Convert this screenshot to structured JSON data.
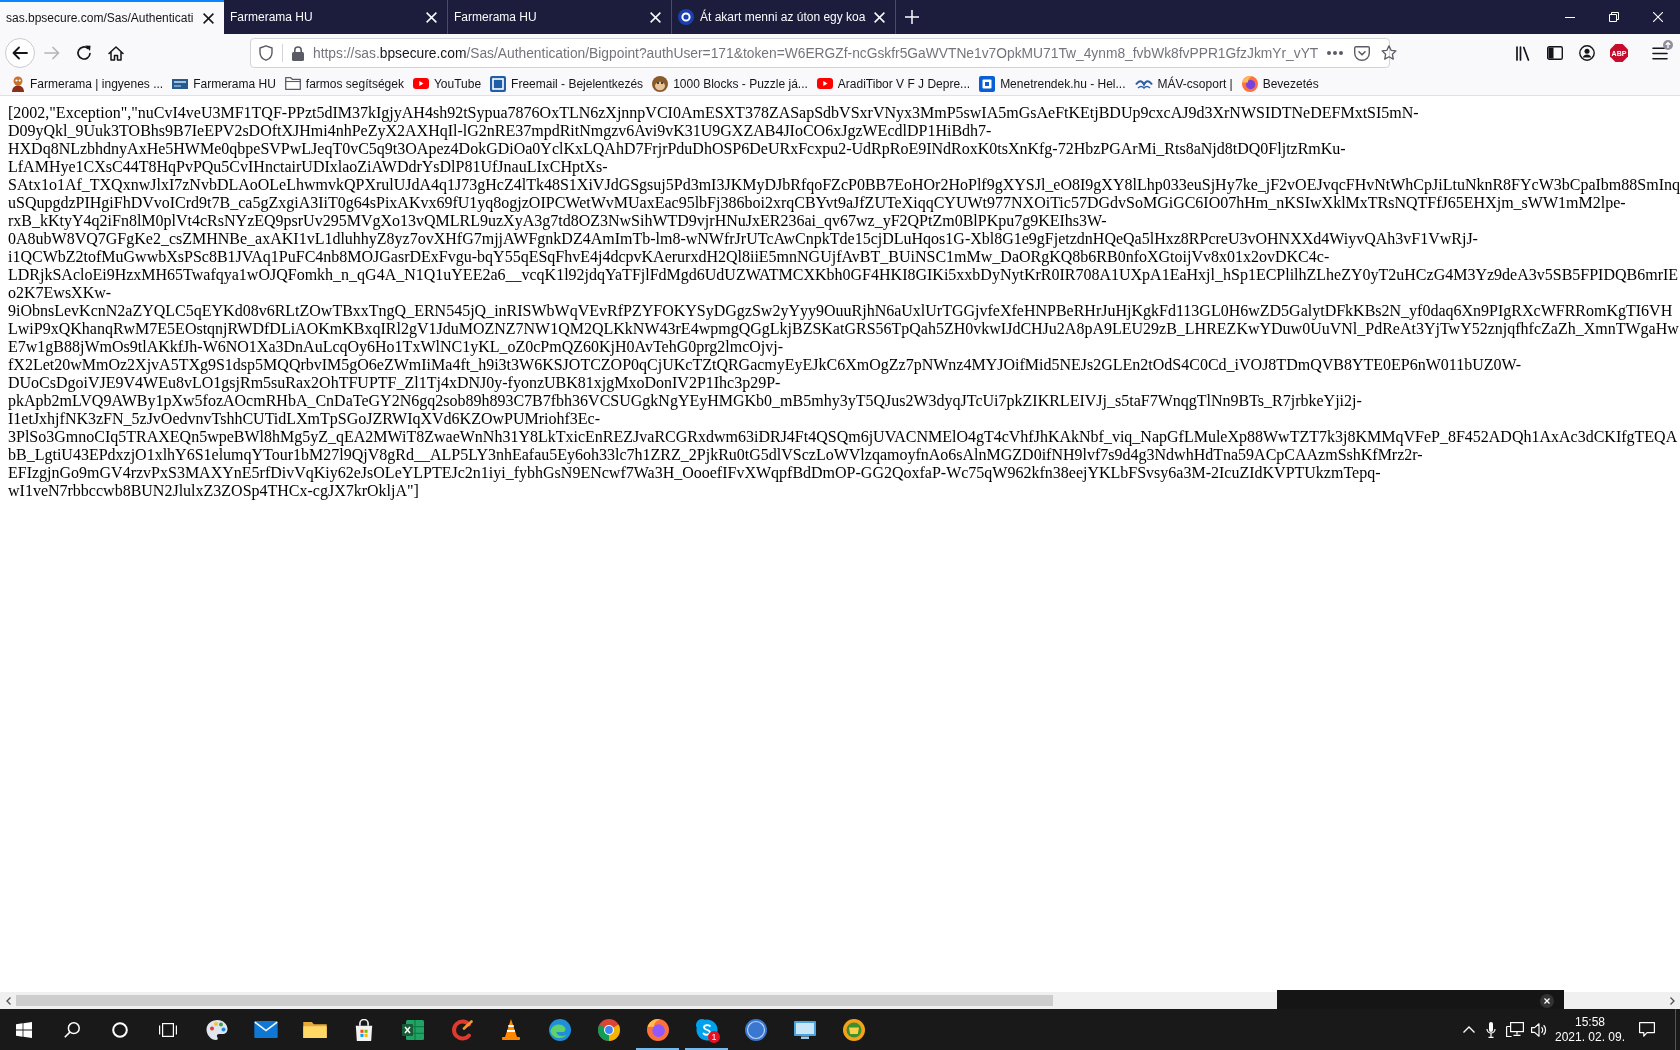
{
  "tabs": [
    {
      "title": "sas.bpsecure.com/Sas/Authenticati",
      "selected": true,
      "favicon": false
    },
    {
      "title": "Farmerama HU",
      "selected": false,
      "favicon": false
    },
    {
      "title": "Farmerama HU",
      "selected": false,
      "favicon": false
    },
    {
      "title": "Át akart menni az úton egy koa",
      "selected": false,
      "favicon": true
    }
  ],
  "toolbar": {
    "nav_buttons": [
      {
        "disabled": false
      },
      {
        "disabled": true
      },
      {
        "disabled": false
      },
      {
        "disabled": false
      }
    ],
    "url": {
      "scheme_host": "https://sas.",
      "domain": "bpsecure.com",
      "path": "/Sas/Authentication/Bigpoint?authUser=171&token=W6ERGZf-ncGskfr5GaWVTNe1v7OpkMU71Tw_4ynm8_fvbWk8fvPPR1GfzJkmYr_vYT"
    },
    "extension_label": "ABP"
  },
  "bookmarks": [
    {
      "label": "Farmerama | ingyenes ..."
    },
    {
      "label": "Farmerama HU"
    },
    {
      "label": "farmos segítségek"
    },
    {
      "label": "YouTube"
    },
    {
      "label": "Freemail - Bejelentkezés"
    },
    {
      "label": "1000 Blocks - Puzzle já..."
    },
    {
      "label": "AradiTibor V F J Depre..."
    },
    {
      "label": "Menetrendek.hu - Hel..."
    },
    {
      "label": "MÁV-csoport |"
    },
    {
      "label": "Bevezetés"
    }
  ],
  "page": {
    "lines": [
      "[2002,\"Exception\",\"nuCvI4veU3MF1TQF-PPzt5dIM37kIgjyAH4sh92tSypua7876OxTLN6zXjnnpVCI0AmESXT378ZASapSdbVSxrVNyx3MmP5swIA5mGsAeFtKEtjBDUp9cxcAJ9d3XrNWSIDTNeDEFMxtSI5mN-",
      "D09yQkl_9Uuk3TOBhs9B7IeEPV2sDOftXJHmi4nhPeZyX2AXHqIl-lG2nRE37mpdRitNmgzv6Avi9vK31U9GXZAB4JIoCO6xJgzWEcdlDP1HiBdh7-",
      "HXDq8NLzbhdnyAxHe5HWMe0qbpeSVPwLJeqT0vC5q9t3OApez4DokGDiOa0YclKxLQAhD7FrjrPduDhOSP6DeURxFcxpu2-UdRpRoE9INdRoxK0tsXnKfg-72HbzPGArMi_Rts8aNjd8tDQ0FljtzRmKu-",
      "LfAMHye1CXsC44T8HqPvPQu5CvIHnctairUDIxlaoZiAWDdrYsDlP81UfJnauLIxCHptXs-",
      "SAtx1o1Af_TXQxnwJlxI7zNvbDLAoOLeLhwmvkQPXrulUJdA4q1J73gHcZ4lTk48S1XiVJdGSgsuj5Pd3mI3JKMyDJbRfqoFZcP0BB7EoHOr2HoPlf9gXYSJl_eO8I9gXY8lLhp033euSjHy7ke_jF2vOEJvqcFHvNtWhCpJiLtuNknR8FYcW3bCpaIbm88SmInq",
      "uSQupgdzPIHgiFhDVvoICrd9t7B_ca5gZxgiA3IiT0g64sPixAKvx69fU1yq8ogjzOIPCWetWvMUaxEac95lbFj386boi2xrqCBYvt9aJfZUTeXiqqCYUWt977NXOiTic57DGdvSoMGiGC6IO07hHm_nKSIwXklMxTRsNQTFfJ65EHXjm_sWW1mM2lpe-",
      "rxB_kKtyY4q2iFn8lM0plVt4cRsNYzEQ9psrUv295MVgXo13vQMLRL9uzXyA3g7td8OZ3NwSihWTD9vjrHNuJxER236ai_qv67wz_yF2QPtZm0BlPKpu7g9KEIhs3W-",
      "0A8ubW8VQ7GFgKe2_csZMHNBe_axAKI1vL1dluhhyZ8yz7ovXHfG7mjjAWFgnkDZ4AmImTb-lm8-wNWfrJrUTcAwCnpkTde15cjDLuHqos1G-Xbl8G1e9gFjetzdnHQeQa5lHxz8RPcreU3vOHNXXd4WiyvQAh3vF1VwRjJ-",
      "i1QCWbZ2tofMuGwwbXsPSc8B1JVAq1PuFC4nb8MOJGasrDExFvgu-bqY55qESqFhvE4j4dcpvKAerurxdH2Ql8iiE5mnNGUjfAvBT_BUiNSC1mMw_DaORgKQ8b6RB0nfoXGtoijVv8x01x2ovDKC4c-",
      "LDRjkSAcloEi9HzxMH65Twafqya1wOJQFomkh_n_qG4A_N1Q1uYEE2a6__vcqK1l92jdqYaTFjlFdMgd6UdUZWATMCXKbh0GF4HKI8GIKi5xxbDyNytKrR0IR708A1UXpA1EaHxjl_hSp1ECPlilhZLheZY0yT2uHCzG4M3Yz9deA3v5SB5FPIDQB6mrIE",
      "o2K7EwsXKw-",
      "9iObnsLevKcnN2aZYQLC5qEYKd08v6RLtZOwTBxxTngQ_ERN545jQ_inRISWbWqVEvRfPZYFOKYSyDGgzSw2yYyy9OuuRjhN6aUxlUrTGGjvfeXfeHNPBeRHrJuHjKgkFd113GL0H6wZD5GalytDFkKBs2N_yf0daq6Xn9PIgRXcWFRRomKgTI6VH",
      "LwiP9xQKhanqRwM7E5EOstqnjRWDfDLiAOKmKBxqIRl2gV1JduMOZNZ7NW1QM2QLKkNW43rE4wpmgQGgLkjBZSKatGRS56TpQah5ZH0vkwIJdCHJu2A8pA9LEU29zB_LHREZKwYDuw0UuVNl_PdReAt3YjTwY52znjqfhfcZaZh_XmnTWgaHw",
      "E7w1gB88jWmOs9tlAKkfJh-W6NO1Xa3DnAuLcqOy6Ho1TxWlNC1yKL_oZ0cPmQZ60KjH0AvTehG0prg2lmcOjvj-",
      "fX2Let20wMmOz2XjvA5TXg9S1dsp5MQQrbvIM5gO6eZWmIiMa4ft_h9i3t3W6KSJOTCZOP0qCjUKcTZtQRGacmyEyEJkC6XmOgZz7pNWnz4MYJOifMid5NEJs2GLEn2tOdS4C0Cd_iVOJ8TDmQVB8YTE0EP6nW011bUZ0W-",
      "DUoCsDgoiVJE9V4WEu8vLO1gsjRm5suRax2OhTFUPTF_Zl1Tj4xDNJ0y-fyonzUBK81xjgMxoDonIV2P1Ihc3p29P-",
      "pkApb2mLVQ9AWBy1pXw5fozAOcmRHbA_CnDaTeGY2N6gq2sob89h893C7B7fbh36VCSUGgkNgYEyHMGKb0_mB5mhy3yT5QJus2W3dyqJTcUi7pkZIKRLEIVJj_s5taF7WnqgTlNn9BTs_R7jrbkeYji2j-",
      "I1etJxhjfNK3zFN_5zJvOedvnvTshhCUTidLXmTpSGoJZRWIqXVd6KZOwPUMriohf3Ec-",
      "3PlSo3GmnoCIq5TRAXEQn5wpeBWl8hMg5yZ_qEA2MWiT8ZwaeWnNh31Y8LkTxicEnREZJvaRCGRxdwm63iDRJ4Ft4QSQm6jUVACNMElO4gT4cVhfJhKAkNbf_viq_NapGfLMuleXp88WwTZT7k3j8KMMqVFeP_8F452ADQh1AxAc3dCKIfgTEQA",
      "bB_LgtiU43EPdxzjO1xlhY6S1elumqYTour1bM27l9QjV8gRd__ALP5LY3nhEafau5Ey6oh33lc7h1ZRZ_2PjkRu0tG5dlVSczLoWVlzqamoyfnAo6sAlnMGZD0ifNH9lvf7s9d4g3NdwhHdTna59ACpCAAzmSshKfMrz2r-",
      "EFIzgjnGo9mGV4rzvPxS3MAXYnE5rfDivVqKiy62eJsOLeYLPTEJc2n1iyi_fybhGsN9ENcwf7Wa3H_OooefIFvXWqpfBdDmOP-GG2QoxfaP-Wc75qW962kfn38eejYKLbFSvsy6a3M-2IcuZIdKVPTUkzmTepq-",
      "wI1veN7rbbccwb8BUN2JlulxZ3ZOSp4THCx-cgJX7krOkljA\"]"
    ]
  },
  "taskbar": {
    "apps": [
      {
        "running": false
      },
      {
        "running": false
      },
      {
        "running": false
      },
      {
        "running": false
      },
      {
        "running": false
      },
      {
        "running": false
      },
      {
        "running": false
      },
      {
        "running": false
      },
      {
        "running": false
      },
      {
        "running": true
      },
      {
        "running": true,
        "badge": "1"
      },
      {
        "running": false
      },
      {
        "running": false
      },
      {
        "running": false
      }
    ],
    "clock": {
      "time": "15:58",
      "date": "2021. 02. 09."
    }
  }
}
